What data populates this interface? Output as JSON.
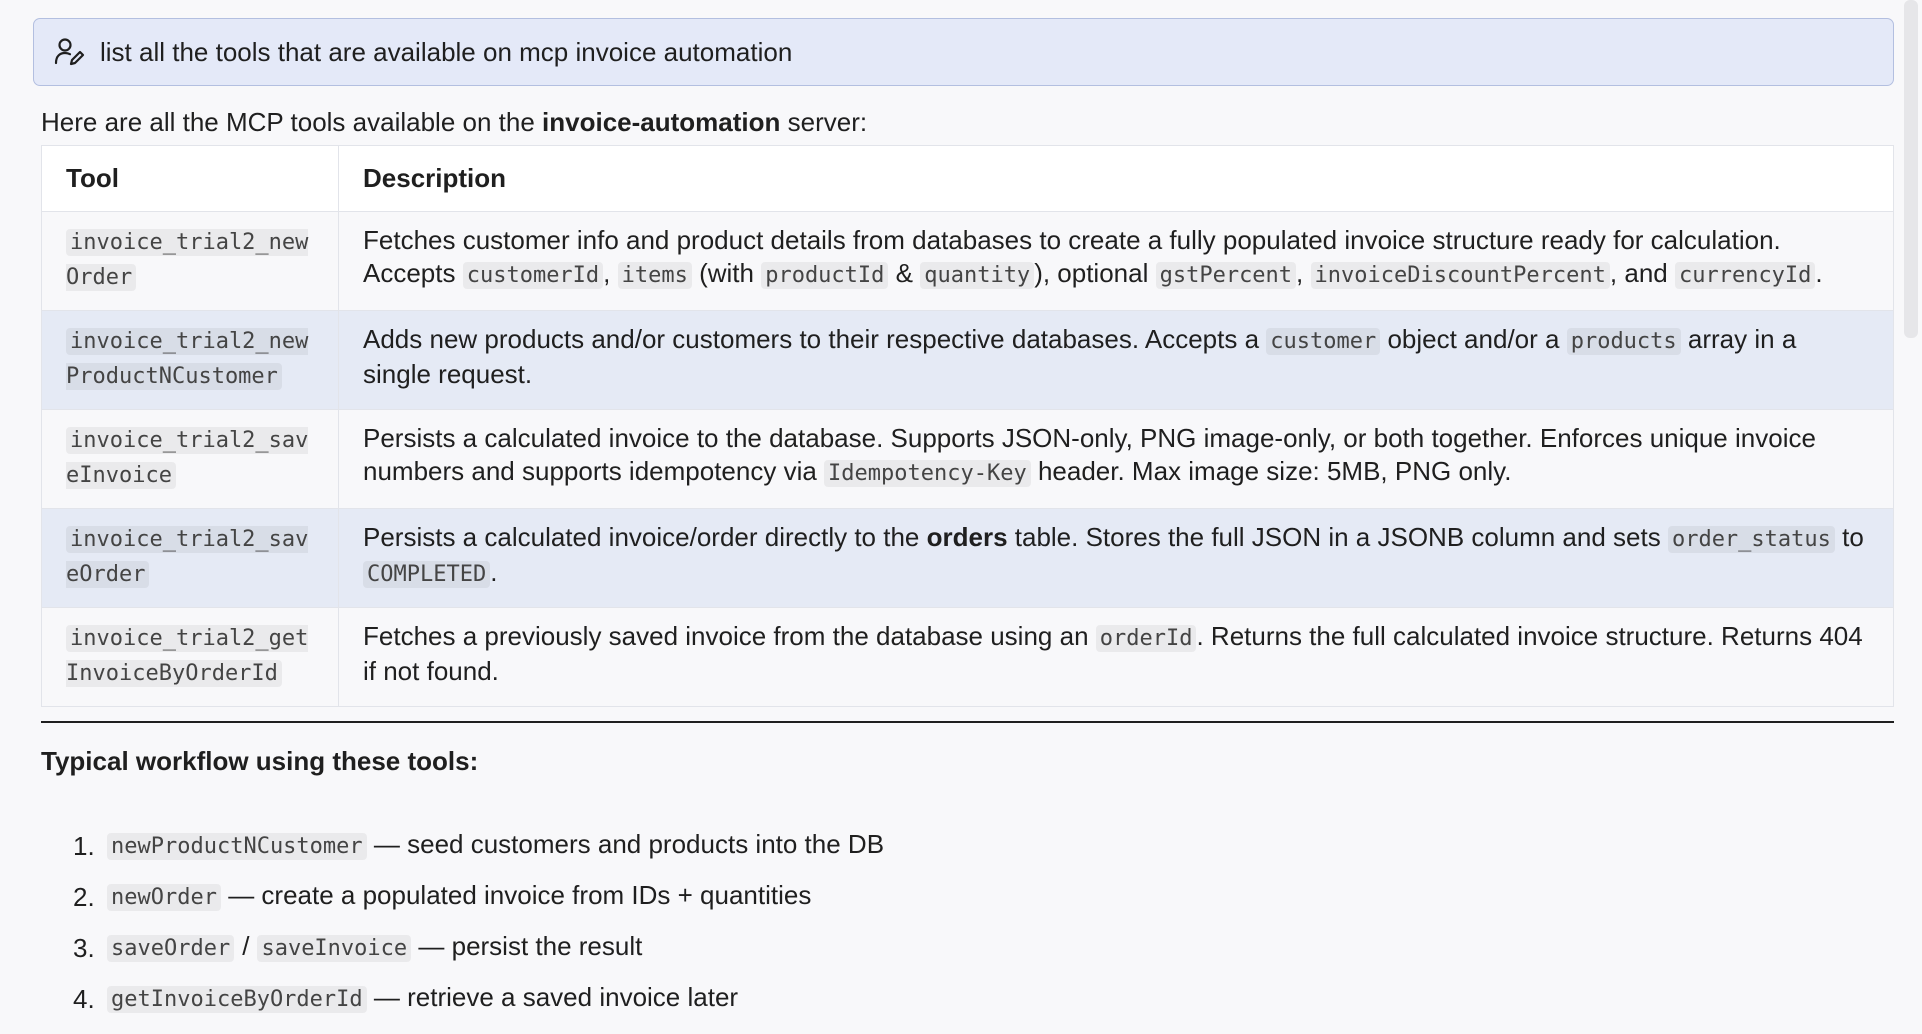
{
  "prompt": {
    "icon": "user-edit-icon",
    "text": "list all the tools that are available on mcp invoice automation"
  },
  "intro": {
    "before": "Here are all the MCP tools available on the ",
    "server_name": "invoice-automation",
    "after": " server:"
  },
  "table": {
    "headers": [
      "Tool",
      "Description"
    ],
    "rows": [
      {
        "tool": "invoice_trial2_newOrder",
        "desc": [
          {
            "t": "Fetches customer info and product details from databases to create a fully populated invoice structure ready for calculation. Accepts "
          },
          {
            "c": "customerId"
          },
          {
            "t": ", "
          },
          {
            "c": "items"
          },
          {
            "t": " (with "
          },
          {
            "c": "productId"
          },
          {
            "t": " & "
          },
          {
            "c": "quantity"
          },
          {
            "t": "), optional "
          },
          {
            "c": "gstPercent"
          },
          {
            "t": ", "
          },
          {
            "c": "invoiceDiscountPercent"
          },
          {
            "t": ", and "
          },
          {
            "c": "currencyId"
          },
          {
            "t": "."
          }
        ]
      },
      {
        "tool": "invoice_trial2_newProductNCustomer",
        "desc": [
          {
            "t": "Adds new products and/or customers to their respective databases. Accepts a "
          },
          {
            "c": "customer"
          },
          {
            "t": " object and/or a "
          },
          {
            "c": "products"
          },
          {
            "t": " array in a single request."
          }
        ]
      },
      {
        "tool": "invoice_trial2_saveInvoice",
        "desc": [
          {
            "t": "Persists a calculated invoice to the database. Supports JSON-only, PNG image-only, or both together. Enforces unique invoice numbers and supports idempotency via "
          },
          {
            "c": "Idempotency-Key"
          },
          {
            "t": " header. Max image size: 5MB, PNG only."
          }
        ]
      },
      {
        "tool": "invoice_trial2_saveOrder",
        "desc": [
          {
            "t": "Persists a calculated invoice/order directly to the "
          },
          {
            "b": "orders"
          },
          {
            "t": " table. Stores the full JSON in a JSONB column and sets "
          },
          {
            "c": "order_status"
          },
          {
            "t": " to "
          },
          {
            "c": "COMPLETED"
          },
          {
            "t": "."
          }
        ]
      },
      {
        "tool": "invoice_trial2_getInvoiceByOrderId",
        "desc": [
          {
            "t": "Fetches a previously saved invoice from the database using an "
          },
          {
            "c": "orderId"
          },
          {
            "t": ". Returns the full calculated invoice structure. Returns 404 if not found."
          }
        ]
      }
    ]
  },
  "workflow": {
    "title": "Typical workflow using these tools:",
    "steps": [
      {
        "num": "1.",
        "codes": [
          "newProductNCustomer"
        ],
        "text": " — seed customers and products into the DB"
      },
      {
        "num": "2.",
        "codes": [
          "newOrder"
        ],
        "text": " — create a populated invoice from IDs + quantities"
      },
      {
        "num": "3.",
        "codes": [
          "saveOrder",
          "saveInvoice"
        ],
        "separator": "/",
        "text": " — persist the result"
      },
      {
        "num": "4.",
        "codes": [
          "getInvoiceByOrderId"
        ],
        "text": " — retrieve a saved invoice later"
      }
    ]
  }
}
